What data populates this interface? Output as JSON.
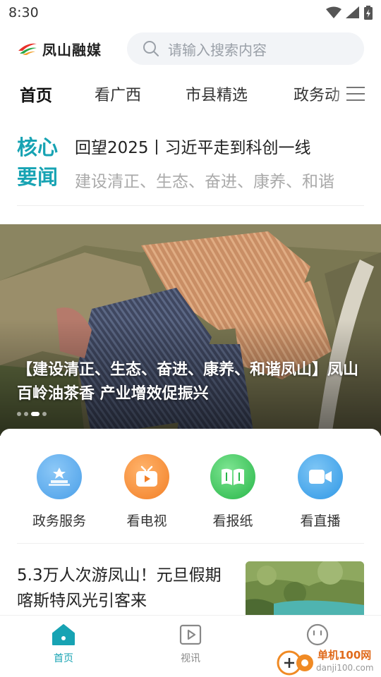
{
  "status_bar": {
    "time": "8:30",
    "icons": [
      "wifi-icon",
      "signal-icon",
      "battery-icon"
    ]
  },
  "header": {
    "app_name": "凤山融媒",
    "search": {
      "placeholder": "请输入搜索内容"
    }
  },
  "tabs": [
    {
      "label": "首页",
      "active": true
    },
    {
      "label": "看广西",
      "active": false
    },
    {
      "label": "市县精选",
      "active": false
    },
    {
      "label": "政务动",
      "active": false
    }
  ],
  "core_news": {
    "label_line1": "核心",
    "label_line2": "要闻",
    "headline": "回望2025丨习近平走到科创一线",
    "subline": "建设清正、生态、奋进、康养、和谐"
  },
  "banner": {
    "caption": "【建设清正、生态、奋进、康养、和谐凤山】凤山百岭油茶香 产业增效促振兴",
    "dots_count": 4,
    "active_dot": 2
  },
  "services": [
    {
      "label": "政务服务",
      "icon": "government-service-icon",
      "color": "#5aaef0"
    },
    {
      "label": "看电视",
      "icon": "tv-icon",
      "color": "#f5933a"
    },
    {
      "label": "看报纸",
      "icon": "newspaper-icon",
      "color": "#3cc95a"
    },
    {
      "label": "看直播",
      "icon": "live-camera-icon",
      "color": "#3aa5ea"
    }
  ],
  "article": {
    "title": "5.3万人次游凤山！元旦假期喀斯特风光引客来"
  },
  "bottom_nav": [
    {
      "label": "首页",
      "icon": "home-icon",
      "active": true
    },
    {
      "label": "视讯",
      "icon": "video-icon",
      "active": false
    },
    {
      "label": "",
      "icon": "smiley-icon",
      "active": false
    }
  ],
  "watermark": {
    "name": "单机100网",
    "url": "danji100.com"
  },
  "colors": {
    "accent": "#17a3b3",
    "text": "#222222",
    "muted": "#aaaaaa"
  }
}
